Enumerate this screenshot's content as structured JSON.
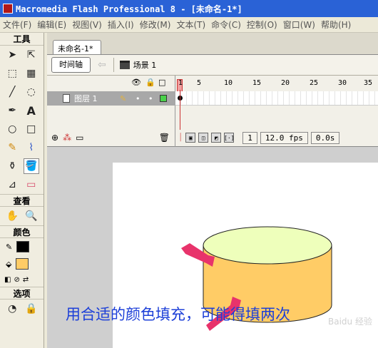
{
  "window": {
    "title": "Macromedia Flash Professional 8 - [未命名-1*]"
  },
  "menu": [
    "文件(F)",
    "编辑(E)",
    "视图(V)",
    "插入(I)",
    "修改(M)",
    "文本(T)",
    "命令(C)",
    "控制(O)",
    "窗口(W)",
    "帮助(H)"
  ],
  "toolbox": {
    "tools_label": "工具",
    "view_label": "查看",
    "colors_label": "颜色",
    "options_label": "选项",
    "stroke_color": "#000000",
    "fill_color": "#ffcc66"
  },
  "document": {
    "tab_label": "未命名-1*",
    "timeline_button": "时间轴",
    "scene_label": "场景 1"
  },
  "timeline": {
    "layer_name": "图层 1",
    "ruler_marks": [
      "1",
      "5",
      "10",
      "15",
      "20",
      "25",
      "30",
      "35"
    ],
    "current_frame": "1",
    "fps": "12.0 fps",
    "elapsed": "0.0s"
  },
  "stage": {
    "caption": "用合适的颜色填充，可能得填两次",
    "watermark": "Baidu 经验",
    "cylinder_top_color": "#eeffbb",
    "cylinder_body_color": "#ffcc66",
    "arrow_color": "#e8336b"
  }
}
